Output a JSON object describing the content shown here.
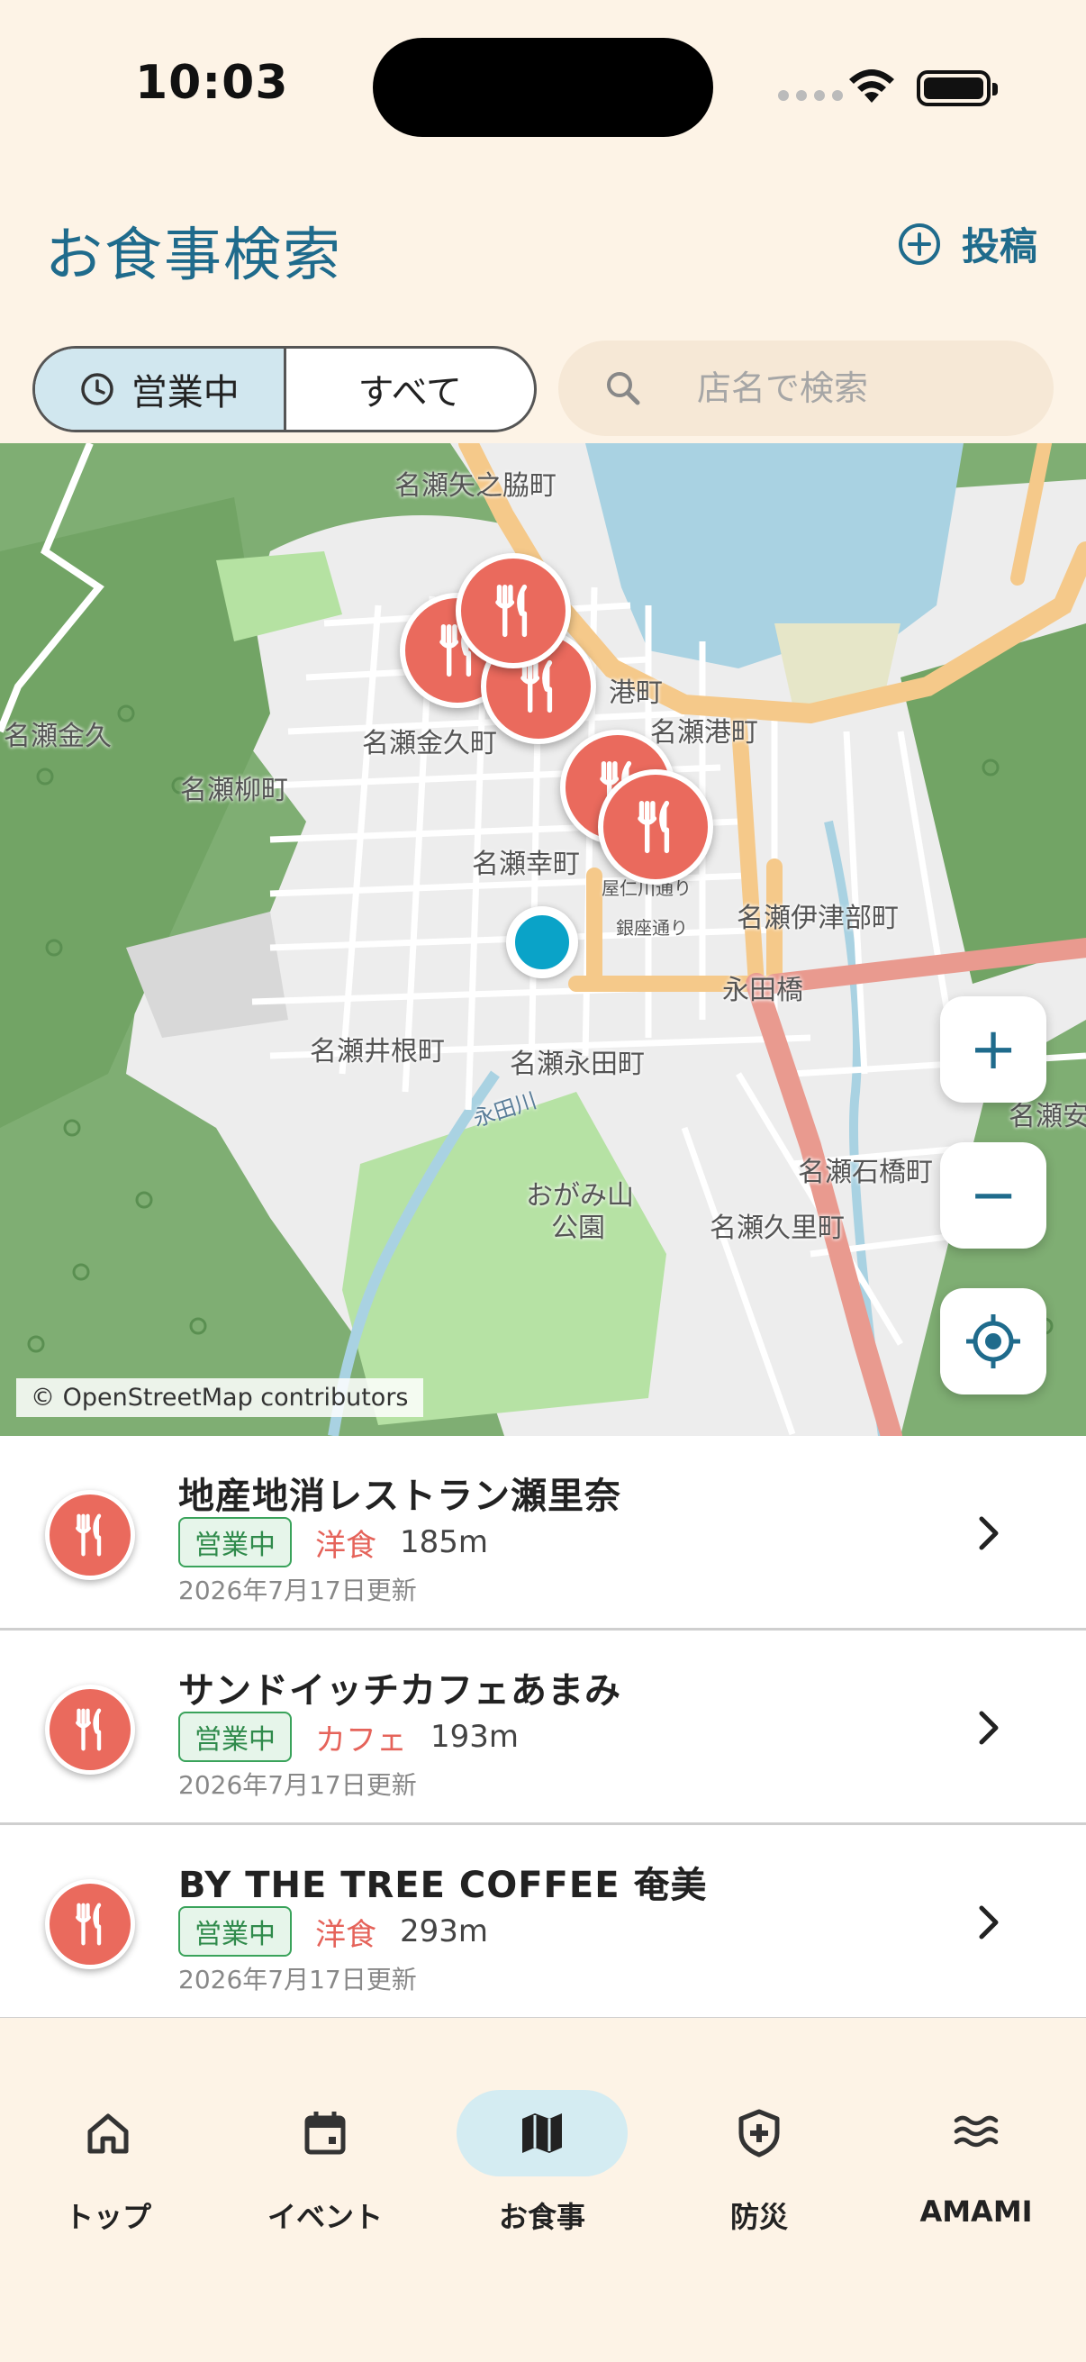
{
  "status_bar": {
    "time": "10:03"
  },
  "header": {
    "title": "お食事検索",
    "post_label": "投稿"
  },
  "filters": {
    "open_now_label": "営業中",
    "all_label": "すべて",
    "search_placeholder": "店名で検索"
  },
  "map": {
    "labels": [
      "名瀬矢之脇町",
      "名瀬金久",
      "名瀬金久町",
      "名瀬柳町",
      "港町",
      "名瀬港町",
      "名瀬幸町",
      "名瀬伊津部町",
      "永田橋",
      "名瀬井根町",
      "名瀬永田町",
      "永田川",
      "おがみ山",
      "公園",
      "名瀬石橋町",
      "名瀬久里町",
      "名瀬安",
      "屋仁川通り",
      "銀座通り"
    ],
    "attribution": "© OpenStreetMap contributors",
    "zoom_in": "+",
    "zoom_out": "−"
  },
  "restaurants": [
    {
      "name": "地産地消レストラン瀬里奈",
      "status": "営業中",
      "category": "洋食",
      "distance": "185m",
      "updated": "2026年7月17日更新"
    },
    {
      "name": "サンドイッチカフェあまみ",
      "status": "営業中",
      "category": "カフェ",
      "distance": "193m",
      "updated": "2026年7月17日更新"
    },
    {
      "name": "BY THE TREE COFFEE 奄美",
      "status": "営業中",
      "category": "洋食",
      "distance": "293m",
      "updated": "2026年7月17日更新"
    }
  ],
  "nav": [
    {
      "label": "トップ",
      "icon": "home-icon"
    },
    {
      "label": "イベント",
      "icon": "calendar-icon"
    },
    {
      "label": "お食事",
      "icon": "map-icon",
      "active": true
    },
    {
      "label": "防災",
      "icon": "shield-plus-icon"
    },
    {
      "label": "AMAMI",
      "icon": "waves-icon"
    }
  ],
  "colors": {
    "accent": "#1f6b8c",
    "pin": "#ea6a5d",
    "open_badge": "#2f8a4b",
    "background": "#fdf3e6"
  }
}
